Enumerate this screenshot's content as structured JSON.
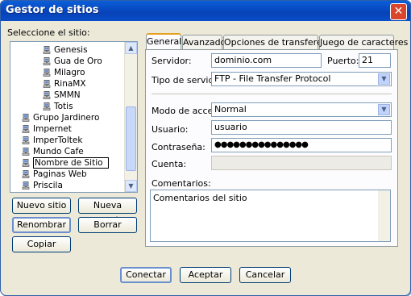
{
  "window": {
    "title": "Gestor de sitios",
    "close_glyph": "✕"
  },
  "left": {
    "select_label": "Seleccione el sitio:",
    "sites": [
      {
        "label": "Genesis",
        "level": 2
      },
      {
        "label": "Gua de Oro",
        "level": 2
      },
      {
        "label": "Milagro",
        "level": 2
      },
      {
        "label": "RinaMX",
        "level": 2
      },
      {
        "label": "SMMN",
        "level": 2
      },
      {
        "label": "Totis",
        "level": 2
      },
      {
        "label": "Grupo Jardinero",
        "level": 1
      },
      {
        "label": "Impernet",
        "level": 1
      },
      {
        "label": "ImperToltek",
        "level": 1
      },
      {
        "label": "Mundo Cafe",
        "level": 1
      },
      {
        "label": "Nombre de Sitio",
        "level": 1,
        "editing": true
      },
      {
        "label": "Paginas Web",
        "level": 1
      },
      {
        "label": "Priscila",
        "level": 1
      }
    ],
    "buttons": {
      "new_site": "Nuevo sitio",
      "new_folder": "Nueva carpeta",
      "rename": "Renombrar",
      "delete": "Borrar",
      "copy": "Copiar"
    }
  },
  "tabs": [
    "General",
    "Avanzado",
    "Opciones de transferencia",
    "Juego de caracteres"
  ],
  "active_tab": "General",
  "form": {
    "server_label": "Servidor:",
    "server_value": "dominio.com",
    "port_label": "Puerto:",
    "port_value": "21",
    "server_type_label": "Tipo de servidor:",
    "server_type_value": "FTP - File Transfer Protocol",
    "access_mode_label": "Modo de acceso:",
    "access_mode_value": "Normal",
    "user_label": "Usuario:",
    "user_value": "usuario",
    "password_label": "Contraseña:",
    "password_value": "●●●●●●●●●●●●●●●",
    "account_label": "Cuenta:",
    "account_value": "",
    "comments_label": "Comentarios:",
    "comments_value": "Comentarios del sitio"
  },
  "footer": {
    "connect": "Conectar",
    "accept": "Aceptar",
    "cancel": "Cancelar"
  },
  "colors": {
    "titlebar": "#0842b8",
    "window_bg": "#ece9d8",
    "tab_highlight": "#e6a020",
    "field_border": "#7f9db9"
  }
}
